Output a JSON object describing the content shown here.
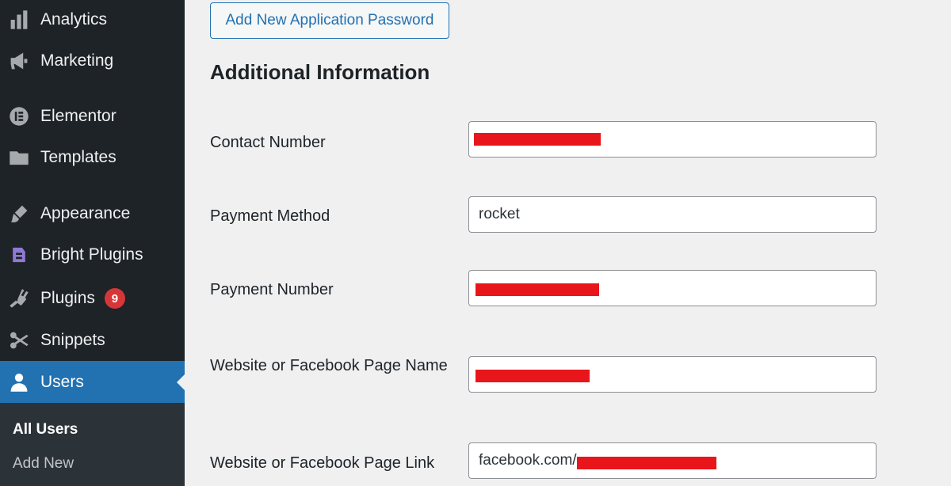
{
  "sidebar": {
    "items": [
      {
        "label": "Analytics",
        "icon": "bar-chart-icon"
      },
      {
        "label": "Marketing",
        "icon": "megaphone-icon"
      },
      {
        "label": "Elementor",
        "icon": "elementor-icon"
      },
      {
        "label": "Templates",
        "icon": "folder-icon"
      },
      {
        "label": "Appearance",
        "icon": "paintbrush-icon"
      },
      {
        "label": "Bright Plugins",
        "icon": "bright-plugins-icon"
      },
      {
        "label": "Plugins",
        "icon": "plug-icon",
        "badge": "9"
      },
      {
        "label": "Snippets",
        "icon": "scissors-icon"
      },
      {
        "label": "Users",
        "icon": "user-icon",
        "active": true
      }
    ],
    "submenu": [
      {
        "label": "All Users",
        "current": true
      },
      {
        "label": "Add New"
      }
    ]
  },
  "main": {
    "add_password_button": "Add New Application Password",
    "section_title": "Additional Information",
    "fields": [
      {
        "label": "Contact Number",
        "value": ""
      },
      {
        "label": "Payment Method",
        "value": "rocket"
      },
      {
        "label": "Payment Number",
        "value": ""
      },
      {
        "label": "Website or Facebook Page Name",
        "value": ""
      },
      {
        "label": "Website or Facebook Page Link",
        "value": "facebook.com/"
      }
    ]
  },
  "colors": {
    "sidebar_bg": "#1d2327",
    "active_bg": "#2271b1",
    "badge_bg": "#d63638",
    "redaction": "#e8161b"
  }
}
